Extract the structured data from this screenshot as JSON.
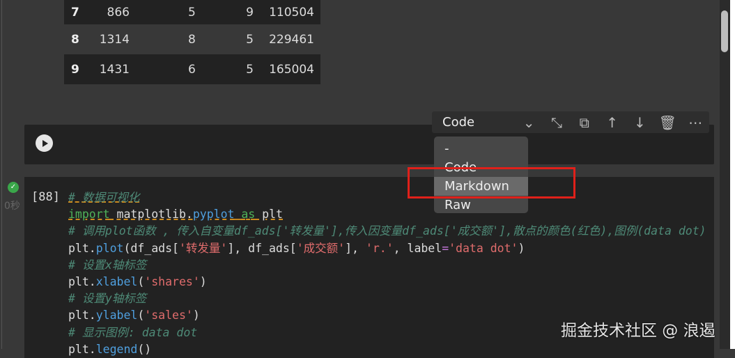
{
  "table": {
    "rows": [
      [
        "7",
        "866",
        "5",
        "9",
        "110504"
      ],
      [
        "8",
        "1314",
        "8",
        "5",
        "229461"
      ],
      [
        "9",
        "1431",
        "6",
        "5",
        "165004"
      ]
    ]
  },
  "toolbar": {
    "cell_type": "Code",
    "icons": [
      "chevron-down-icon",
      "collapse-icon",
      "copy-icon",
      "arrow-up-icon",
      "arrow-down-icon",
      "trash-icon",
      "more-icon"
    ]
  },
  "dropdown": {
    "items": [
      "-",
      "Code",
      "Markdown",
      "Raw"
    ],
    "selected": "Markdown"
  },
  "cell": {
    "prompt": "[88]",
    "status": "0秒",
    "lines": [
      [
        [
          "cm uw",
          "# 数据可视化"
        ]
      ],
      [
        [
          "kw uw",
          "import"
        ],
        [
          "tx uw",
          " matplotlib."
        ],
        [
          "fn uw",
          "pyplot"
        ],
        [
          "tx uw",
          " "
        ],
        [
          "kw uw",
          "as"
        ],
        [
          "tx uw",
          " plt"
        ]
      ],
      [
        [
          "cm",
          "# 调用plot函数 , 传入自变量df_ads['转发量'],传入因变量df_ads['成交额'],散点的颜色(红色),图例(data dot)"
        ]
      ],
      [
        [
          "tx",
          "plt."
        ],
        [
          "fn",
          "plot"
        ],
        [
          "tx",
          "(df_ads["
        ],
        [
          "st",
          "'转发量'"
        ],
        [
          "tx",
          "], df_ads["
        ],
        [
          "st",
          "'成交额'"
        ],
        [
          "tx",
          "], "
        ],
        [
          "st",
          "'r.'"
        ],
        [
          "tx",
          ", label"
        ],
        [
          "op",
          "="
        ],
        [
          "st",
          "'data dot'"
        ],
        [
          "tx",
          ")"
        ]
      ],
      [
        [
          "cm",
          "# 设置x轴标签"
        ]
      ],
      [
        [
          "tx",
          "plt."
        ],
        [
          "fn",
          "xlabel"
        ],
        [
          "tx",
          "("
        ],
        [
          "st",
          "'shares'"
        ],
        [
          "tx",
          ")"
        ]
      ],
      [
        [
          "cm",
          "# 设置y轴标签"
        ]
      ],
      [
        [
          "tx",
          "plt."
        ],
        [
          "fn",
          "ylabel"
        ],
        [
          "tx",
          "("
        ],
        [
          "st",
          "'sales'"
        ],
        [
          "tx",
          ")"
        ]
      ],
      [
        [
          "cm",
          "# 显示图例: data dot"
        ]
      ],
      [
        [
          "tx",
          "plt."
        ],
        [
          "fn",
          "legend"
        ],
        [
          "tx",
          "()"
        ]
      ]
    ]
  },
  "watermark": "掘金技术社区 @ 浪遏",
  "colors": {
    "highlight_box": "#e0201a",
    "success": "#3aa64a"
  }
}
